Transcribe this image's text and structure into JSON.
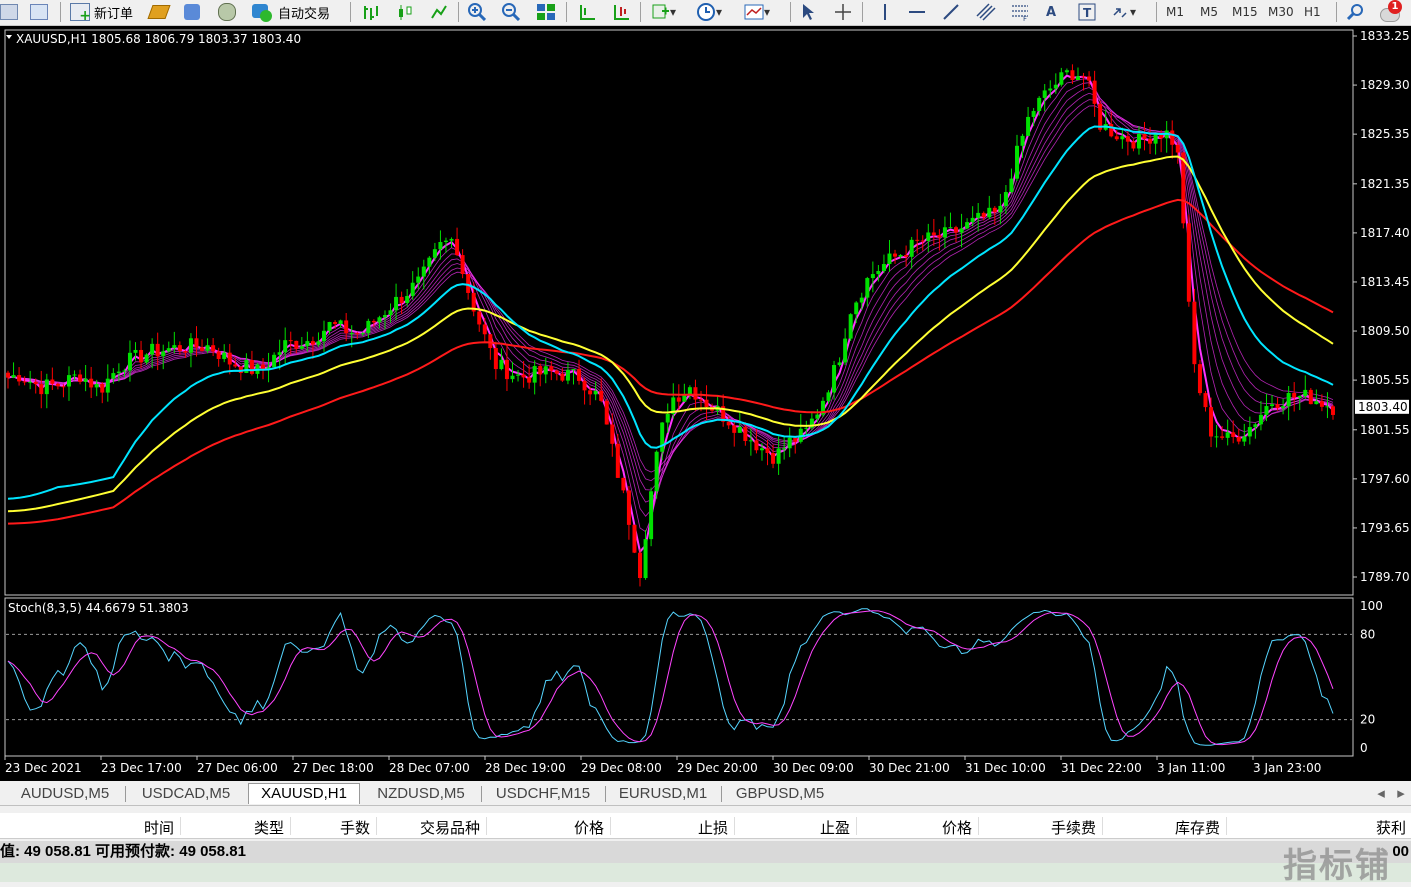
{
  "toolbar": {
    "new_order": "新订单",
    "auto_trading": "自动交易",
    "timeframes": [
      "M1",
      "M5",
      "M15",
      "M30",
      "H1"
    ],
    "alert_count": "1"
  },
  "chart": {
    "header": "XAUUSD,H1  1805.68 1806.79 1803.37 1803.40",
    "current_price": "1803.40",
    "price_labels": [
      "1833.25",
      "1829.30",
      "1825.35",
      "1821.35",
      "1817.40",
      "1813.45",
      "1809.50",
      "1805.55",
      "1801.55",
      "1797.60",
      "1793.65",
      "1789.70"
    ],
    "price_levels": [
      1833.25,
      1829.3,
      1825.35,
      1821.35,
      1817.4,
      1813.45,
      1809.5,
      1805.55,
      1801.55,
      1797.6,
      1793.65,
      1789.7
    ],
    "stoch_header": "Stoch(8,3,5) 44.6679 51.3803",
    "stoch_labels": [
      "100",
      "80",
      "20",
      "0"
    ],
    "time_labels": [
      "23 Dec 2021",
      "23 Dec 17:00",
      "27 Dec 06:00",
      "27 Dec 18:00",
      "28 Dec 07:00",
      "28 Dec 19:00",
      "29 Dec 08:00",
      "29 Dec 20:00",
      "30 Dec 09:00",
      "30 Dec 21:00",
      "31 Dec 10:00",
      "31 Dec 22:00",
      "3 Jan 11:00",
      "3 Jan 23:00"
    ],
    "colors": {
      "background": "#000000",
      "bull_candle": "#00e000",
      "bear_candle": "#ff0000",
      "ma_fast": "#00e5ff",
      "ma_mid": "#ffff33",
      "ma_slow": "#ff1a1a",
      "ribbon": "#ff33ff",
      "stoch_main": "#55d5ff",
      "stoch_signal": "#ff44ff"
    }
  },
  "tabs": [
    {
      "label": "AUDUSD,M5",
      "active": false
    },
    {
      "label": "USDCAD,M5",
      "active": false
    },
    {
      "label": "XAUUSD,H1",
      "active": true
    },
    {
      "label": "NZDUSD,M5",
      "active": false
    },
    {
      "label": "USDCHF,M15",
      "active": false
    },
    {
      "label": "EURUSD,M1",
      "active": false
    },
    {
      "label": "GBPUSD,M5",
      "active": false
    }
  ],
  "columns": [
    "时间",
    "类型",
    "手数",
    "交易品种",
    "价格",
    "止损",
    "止盈",
    "价格",
    "手续费",
    "库存费",
    "获利"
  ],
  "balance_text": "值: 49 058.81  可用预付款: 49 058.81",
  "balance_right": "00",
  "watermark": "指标铺"
}
